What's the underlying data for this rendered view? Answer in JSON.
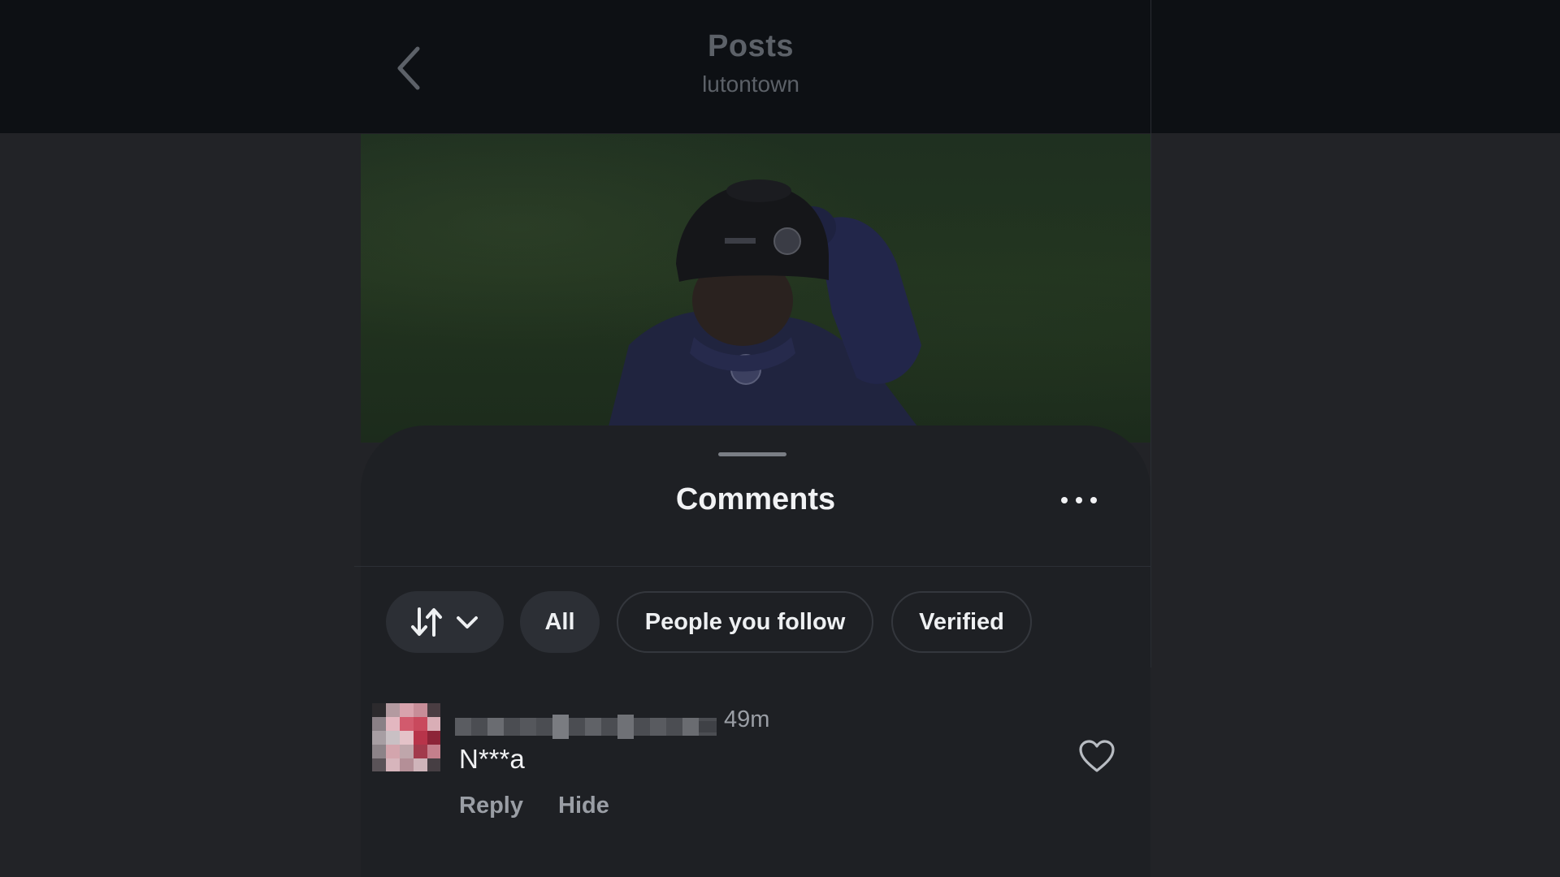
{
  "header": {
    "title": "Posts",
    "subtitle": "lutontown",
    "back_icon": "chevron-left-icon"
  },
  "post": {
    "media_description_icon": "post-photo"
  },
  "comments_sheet": {
    "title": "Comments",
    "more_icon": "more-horizontal-icon",
    "filters": {
      "sort_icon": "sort-arrows-icon",
      "sort_chevron": "chevron-down-icon",
      "all": "All",
      "people_you_follow": "People you follow",
      "verified": "Verified"
    },
    "comment": {
      "timestamp": "49m",
      "text": "N***a",
      "reply": "Reply",
      "hide": "Hide",
      "like_icon": "heart-icon"
    }
  },
  "colors": {
    "background": "#222327",
    "header_bar": "#0d1014",
    "sheet": "#1e2024",
    "chip_filled": "#2c2f35",
    "text_primary": "#f1f2f4",
    "text_secondary": "#9a9ea5"
  }
}
